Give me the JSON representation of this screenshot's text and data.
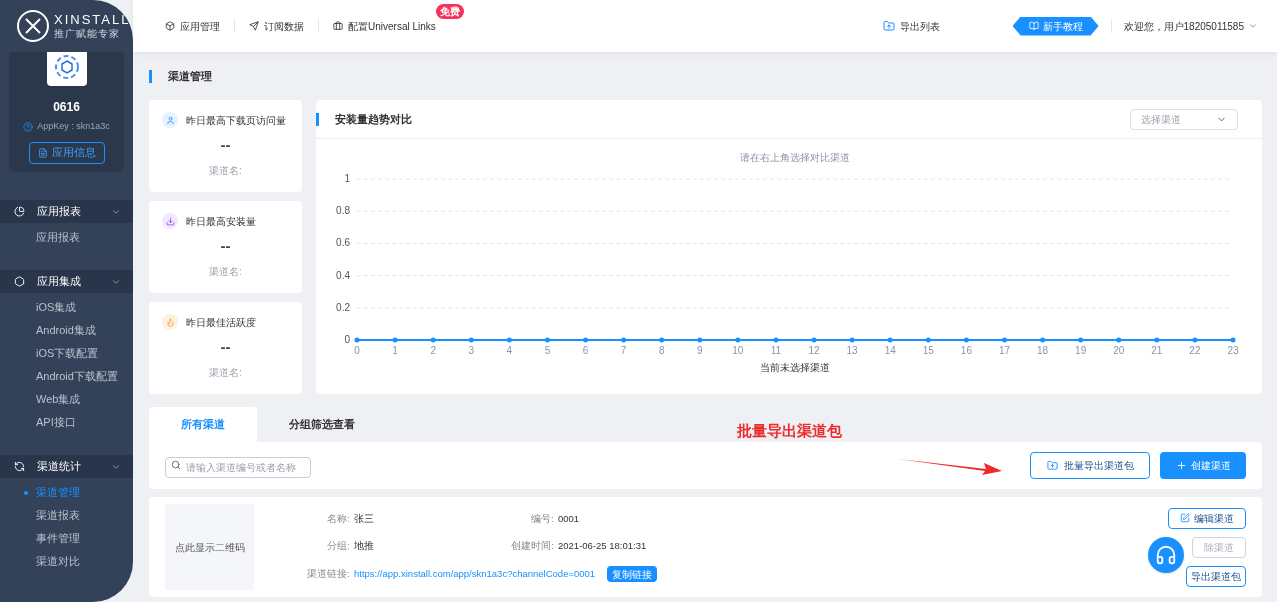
{
  "brand": {
    "name": "XINSTALL",
    "tagline": "推广赋能专家"
  },
  "nav": [
    {
      "label": "应用管理"
    },
    {
      "label": "订阅数据"
    },
    {
      "label": "配置Universal Links",
      "badge": "免费"
    }
  ],
  "header_right": {
    "export_list": "导出列表",
    "tutorial": "新手教程",
    "user": "欢迎您，用户18205011585"
  },
  "app": {
    "name": "0616",
    "appkey": "AppKey : skn1a3c",
    "info_button": "应用信息"
  },
  "sidebar": [
    {
      "label": "应用报表",
      "expanded": true,
      "items": [
        {
          "label": "应用报表",
          "selected": false
        }
      ]
    },
    {
      "label": "应用集成",
      "expanded": true,
      "items": [
        {
          "label": "iOS集成",
          "selected": false
        },
        {
          "label": "Android集成",
          "selected": false
        },
        {
          "label": "iOS下载配置",
          "selected": false
        },
        {
          "label": "Android下载配置",
          "selected": false
        },
        {
          "label": "Web集成",
          "selected": false
        },
        {
          "label": "API接口",
          "selected": false
        }
      ]
    },
    {
      "label": "渠道统计",
      "expanded": true,
      "items": [
        {
          "label": "渠道管理",
          "selected": true
        },
        {
          "label": "渠道报表",
          "selected": false
        },
        {
          "label": "事件管理",
          "selected": false
        },
        {
          "label": "渠道对比",
          "selected": false
        }
      ]
    }
  ],
  "page_title": "渠道管理",
  "stats": [
    {
      "kind": "visits",
      "title": "昨日最高下载页访问量",
      "value": "--",
      "caption": "渠道名:"
    },
    {
      "kind": "installs",
      "title": "昨日最高安装量",
      "value": "--",
      "caption": "渠道名:"
    },
    {
      "kind": "activity",
      "title": "昨日最佳活跃度",
      "value": "--",
      "caption": "渠道名:"
    }
  ],
  "chart": {
    "title": "安装量趋势对比",
    "select_placeholder": "选择渠道",
    "chart_data": {
      "type": "line",
      "title": "请在右上角选择对比渠道",
      "xlabel": "当前未选择渠道",
      "x": [
        0,
        1,
        2,
        3,
        4,
        5,
        6,
        7,
        8,
        9,
        10,
        11,
        12,
        13,
        14,
        15,
        16,
        17,
        18,
        19,
        20,
        21,
        22,
        23
      ],
      "xlim": [
        0,
        23
      ],
      "xticks": [
        0,
        1,
        2,
        3,
        4,
        5,
        6,
        7,
        8,
        9,
        10,
        11,
        12,
        13,
        14,
        15,
        16,
        17,
        18,
        19,
        20,
        21,
        22,
        23
      ],
      "ylim": [
        0,
        1
      ],
      "yticks": [
        0,
        0.2,
        0.4,
        0.6,
        0.8,
        1
      ],
      "grid": true,
      "series": [
        {
          "color": "#1890ff",
          "values": [
            0,
            0,
            0,
            0,
            0,
            0,
            0,
            0,
            0,
            0,
            0,
            0,
            0,
            0,
            0,
            0,
            0,
            0,
            0,
            0,
            0,
            0,
            0,
            0
          ]
        }
      ]
    }
  },
  "tabs": [
    {
      "label": "所有渠道",
      "selected": true
    },
    {
      "label": "分组筛选查看",
      "selected": false
    }
  ],
  "search": {
    "placeholder": "请输入渠道编号或者名称"
  },
  "annotation": "批量导出渠道包",
  "actions": {
    "export": "批量导出渠道包",
    "create": "创建渠道"
  },
  "channels": [
    {
      "qr": "点此显示二维码",
      "fields": [
        {
          "label": "名称:",
          "value": "张三"
        },
        {
          "label": "编号:",
          "value": "0001"
        },
        {
          "label": "分组:",
          "value": "地推"
        },
        {
          "label": "创建时间:",
          "value": "2021-06-25 18:01:31"
        }
      ],
      "link_label": "渠道链接:",
      "link": "https://app.xinstall.com/app/skn1a3c?channelCode=0001",
      "copy": "复制链接",
      "buttons": {
        "edit": "编辑渠道",
        "delete": "除渠道",
        "export": "导出渠道包"
      }
    }
  ]
}
